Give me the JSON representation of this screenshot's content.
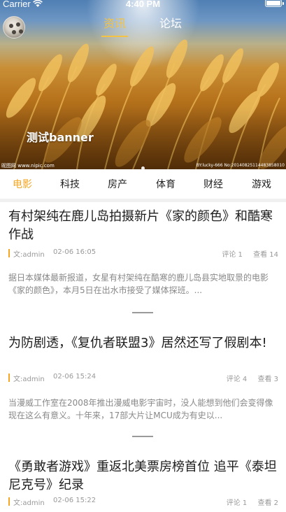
{
  "status_bar": {
    "carrier": "Carrier",
    "time": "4:40 PM"
  },
  "top_tabs": [
    {
      "label": "资讯",
      "active": true
    },
    {
      "label": "论坛",
      "active": false
    }
  ],
  "banner": {
    "title": "测试banner",
    "watermark_left": "昵图网 www.nipic.com",
    "watermark_right": "BY:lucky-666 No:20140825114483858010"
  },
  "categories": [
    {
      "label": "电影",
      "active": true
    },
    {
      "label": "科技",
      "active": false
    },
    {
      "label": "房产",
      "active": false
    },
    {
      "label": "体育",
      "active": false
    },
    {
      "label": "财经",
      "active": false
    },
    {
      "label": "游戏",
      "active": false
    }
  ],
  "colors": {
    "accent": "#f5a623",
    "tab_active": "#f5c343",
    "meta_text": "#999999",
    "summary_text": "#888888"
  },
  "articles": [
    {
      "title": "有村架纯在鹿儿岛拍摄新片《家的颜色》和酷寒作战",
      "author": "文:admin",
      "date": "02-06 16:05",
      "comments": "评论 1",
      "views": "查看 14",
      "summary": "据日本媒体最新报道，女星有村架纯在酷寒的鹿儿岛县实地取景的电影《家的颜色》，本月5日在出水市接受了媒体探班。..."
    },
    {
      "title": "为防剧透，《复仇者联盟3》居然还写了假剧本!",
      "author": "文:admin",
      "date": "02-06 15:24",
      "comments": "评论 4",
      "views": "查看 3",
      "summary": "当漫威工作室在2008年推出漫威电影宇宙时，没人能想到他们会变得像现在这么有意义。十年来，17部大片让MCU成为有史以..."
    },
    {
      "title": "《勇敢者游戏》重返北美票房榜首位 追平《泰坦尼克号》纪录",
      "author": "文:admin",
      "date": "02-06 15:22",
      "comments": "评论 1",
      "views": "查看 2",
      "summary": ""
    }
  ]
}
